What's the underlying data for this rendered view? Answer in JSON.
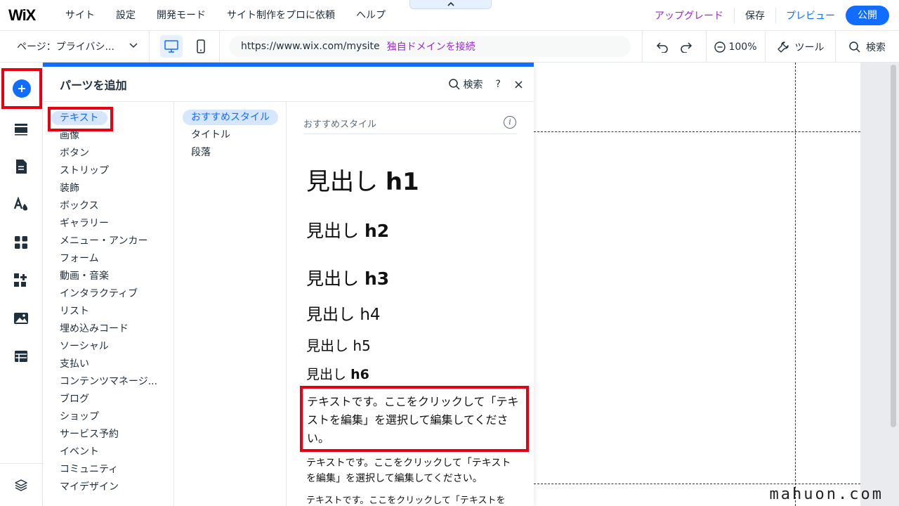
{
  "topbar": {
    "logo": "WiX",
    "menu": [
      "サイト",
      "設定",
      "開発モード",
      "サイト制作をプロに依頼",
      "ヘルプ"
    ],
    "upgrade": "アップグレード",
    "save": "保存",
    "preview": "プレビュー",
    "publish": "公開"
  },
  "toolbar": {
    "page_selector": "ページ：プライバシ...",
    "url": "https://www.wix.com/mysite",
    "connect_domain": "独自ドメインを接続",
    "zoom": "100%",
    "tools": "ツール",
    "search": "検索"
  },
  "panel": {
    "title": "パーツを追加",
    "search": "検索",
    "help": "?",
    "close": "×",
    "categories": [
      "テキスト",
      "画像",
      "ボタン",
      "ストリップ",
      "装飾",
      "ボックス",
      "ギャラリー",
      "メニュー・アンカー",
      "フォーム",
      "動画・音楽",
      "インタラクティブ",
      "リスト",
      "埋め込みコード",
      "ソーシャル",
      "支払い",
      "コンテンツマネージ...",
      "ブログ",
      "ショップ",
      "サービス予約",
      "イベント",
      "コミュニティ",
      "マイデザイン"
    ],
    "subcategories": [
      "おすすめスタイル",
      "タイトル",
      "段落"
    ],
    "preview_title": "おすすめスタイル",
    "headings": [
      {
        "text": "見出し",
        "tag": "h1"
      },
      {
        "text": "見出し",
        "tag": "h2"
      },
      {
        "text": "見出し",
        "tag": "h3"
      },
      {
        "text": "見出し",
        "tag": "h4"
      },
      {
        "text": "見出し",
        "tag": "h5"
      },
      {
        "text": "見出し",
        "tag": "h6"
      }
    ],
    "paragraph_large": "テキストです。ここをクリックして「テキストを編集」を選択して編集してください。",
    "paragraph_medium": "テキストです。ここをクリックして「テキストを編集」を選択して編集してください。",
    "paragraph_small": "テキストです。ここをクリックして「テキストを"
  },
  "watermark": "mahuon.com",
  "colors": {
    "accent": "#116dff",
    "upgrade": "#9a27d5",
    "highlight_outline": "#e60012",
    "selected_bg": "#d6e6fe"
  }
}
